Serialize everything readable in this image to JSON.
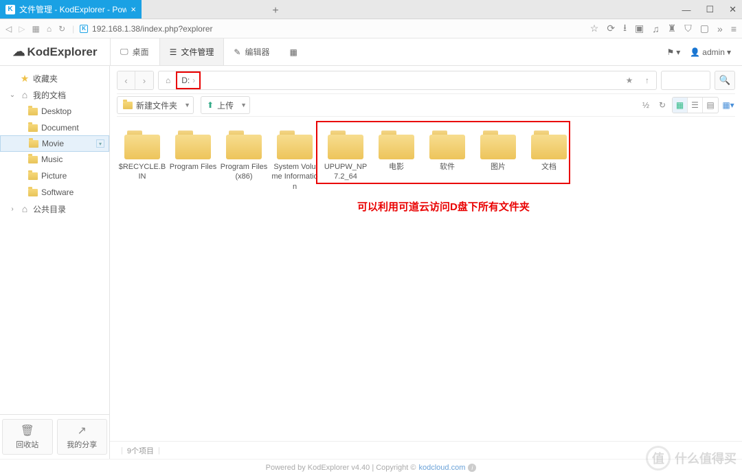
{
  "browser": {
    "tab_title": "文件管理 - KodExplorer - Powered by",
    "url": "192.168.1.38/index.php?explorer"
  },
  "app": {
    "logo": "KodExplorer",
    "tabs": {
      "desktop": "桌面",
      "files": "文件管理",
      "editor": "编辑器"
    },
    "user": "admin"
  },
  "sidebar": {
    "fav": "收藏夹",
    "mydocs": "我的文档",
    "items": [
      "Desktop",
      "Document",
      "Movie",
      "Music",
      "Picture",
      "Software"
    ],
    "public": "公共目录",
    "recycle": "回收站",
    "share": "我的分享"
  },
  "crumb": {
    "drive": "D:"
  },
  "toolbar": {
    "newfolder": "新建文件夹",
    "upload": "上传"
  },
  "search": {
    "placeholder": ""
  },
  "folders": [
    "$RECYCLE.BIN",
    "Program Files",
    "Program Files (x86)",
    "System Volume Information",
    "UPUPW_NP7.2_64",
    "电影",
    "软件",
    "图片",
    "文档"
  ],
  "annotation": "可以利用可道云访问D盘下所有文件夹",
  "status": {
    "count": "9个项目"
  },
  "footer": {
    "text1": "Powered by KodExplorer v4.40 | Copyright © ",
    "link": "kodcloud.com"
  },
  "watermark": "什么值得买"
}
